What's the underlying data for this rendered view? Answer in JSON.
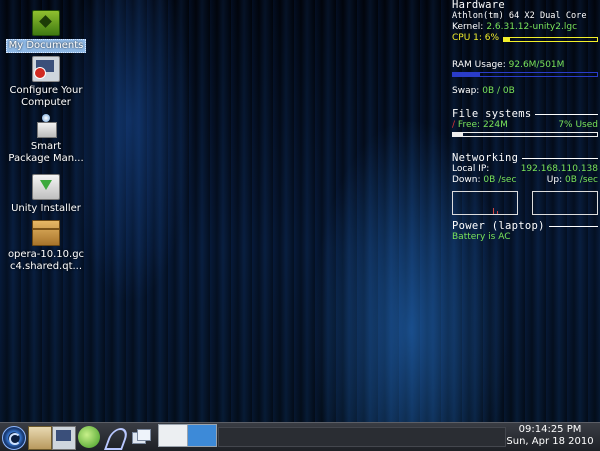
{
  "desktop_icons": [
    {
      "label": "My Documents",
      "icon": "green-folder-icon",
      "selected": true
    },
    {
      "label": "Configure Your Computer",
      "label_lines": [
        "Configure Your",
        "Computer"
      ],
      "icon": "computer-config-icon"
    },
    {
      "label_lines": [
        "Smart",
        "Package Man..."
      ],
      "icon": "package-manager-icon"
    },
    {
      "label_lines": [
        "Unity Installer"
      ],
      "icon": "installer-icon"
    },
    {
      "label_lines": [
        "opera-10.10.gc",
        "c4.shared.qt..."
      ],
      "icon": "package-box-icon"
    }
  ],
  "conky": {
    "hardware": {
      "title": "Hardware",
      "cpu_model": "Athlon(tm) 64 X2 Dual Core",
      "kernel_label": "Kernel:",
      "kernel_value": "2.6.31.12-unity2.lgc",
      "cpu_label": "CPU 1: 6%",
      "cpu_percent": 6
    },
    "memory": {
      "ram_label": "RAM Usage:",
      "ram_value": "92.6M/501M",
      "ram_fraction": 0.185,
      "swap_label": "Swap:",
      "swap_value": "0B",
      "swap_total": "/ 0B"
    },
    "filesystems": {
      "title": "File systems",
      "root": "/",
      "free_label": "Free:",
      "free_value": "224M",
      "used": "7% Used",
      "used_percent": 7
    },
    "networking": {
      "title": "Networking",
      "local_ip_label": "Local IP:",
      "local_ip": "192.168.110.138",
      "down_label": "Down:",
      "down_value": "0B",
      "down_unit": "/sec",
      "up_label": "Up:",
      "up_value": "0B",
      "up_unit": "/sec"
    },
    "power": {
      "title": "Power (laptop)",
      "status": "Battery is AC"
    }
  },
  "taskbar": {
    "clock_time": "09:14:25 PM",
    "clock_date": "Sun, Apr 18 2010"
  },
  "colors": {
    "conky_green": "#79e35a",
    "conky_yellow": "#f2ef2a",
    "ram_bar": "#2a3cc9",
    "selection": "#8fb9e6"
  }
}
